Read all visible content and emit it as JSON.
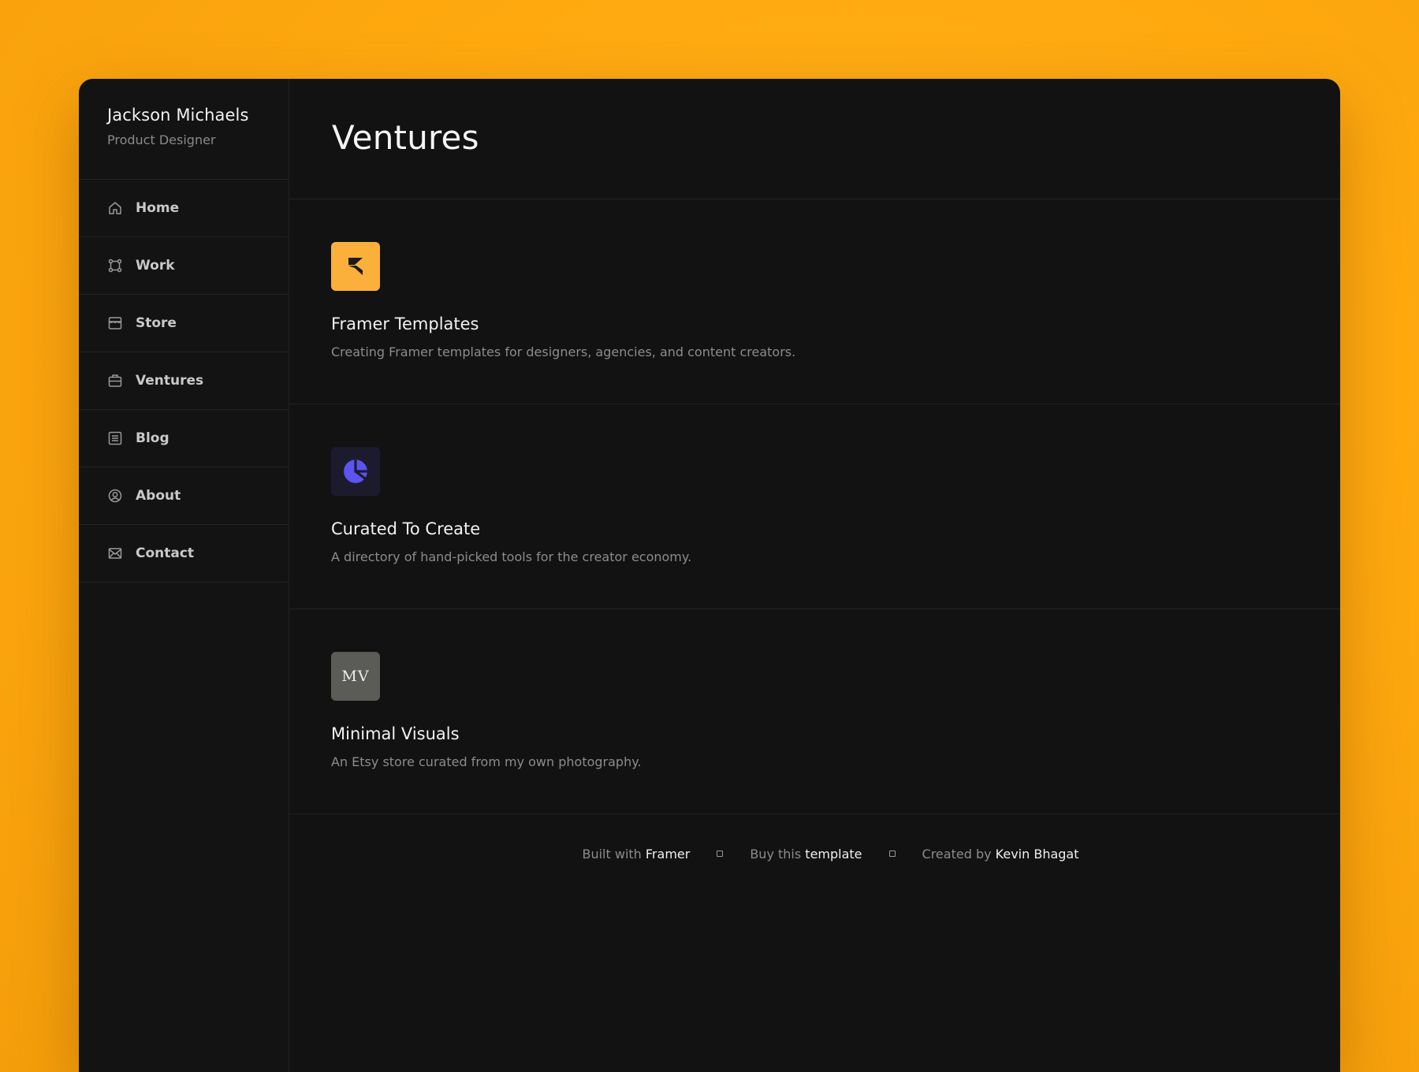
{
  "profile": {
    "name": "Jackson Michaels",
    "role": "Product Designer"
  },
  "nav": [
    {
      "label": "Home",
      "icon": "home-icon"
    },
    {
      "label": "Work",
      "icon": "work-icon"
    },
    {
      "label": "Store",
      "icon": "store-icon"
    },
    {
      "label": "Ventures",
      "icon": "briefcase-icon"
    },
    {
      "label": "Blog",
      "icon": "blog-icon"
    },
    {
      "label": "About",
      "icon": "user-circle-icon"
    },
    {
      "label": "Contact",
      "icon": "mail-icon"
    }
  ],
  "page": {
    "title": "Ventures"
  },
  "ventures": [
    {
      "title": "Framer Templates",
      "description": "Creating Framer templates for designers, agencies, and content creators.",
      "logo": "framer-logo",
      "color": "#fbb03b"
    },
    {
      "title": "Curated To Create",
      "description": "A directory of hand-picked tools for the creator economy.",
      "logo": "curated-logo",
      "color": "#5b54f0"
    },
    {
      "title": "Minimal Visuals",
      "description": "An Etsy store curated from my own photography.",
      "logo": "mv-logo",
      "logo_text": "MV"
    }
  ],
  "footer": {
    "built_prefix": "Built with",
    "built_link": "Framer",
    "buy_prefix": "Buy this",
    "buy_link": "template",
    "created_prefix": "Created by",
    "created_link": "Kevin Bhagat"
  },
  "colors": {
    "background": "#ffa90f",
    "panel": "#121212",
    "accent": "#fbb03b"
  }
}
